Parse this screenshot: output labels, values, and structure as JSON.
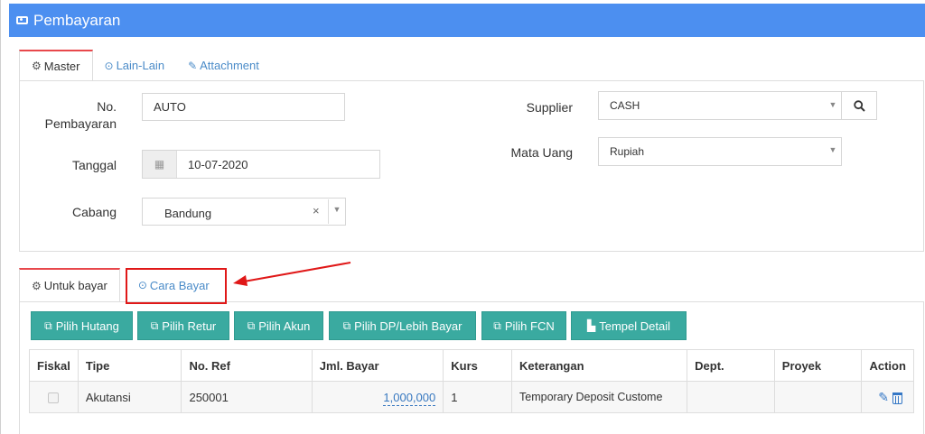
{
  "title": "Pembayaran",
  "top_tabs": [
    {
      "label": "Master",
      "icon": "cogs-icon",
      "active": true
    },
    {
      "label": "Lain-Lain",
      "icon": "check-circle-icon",
      "active": false
    },
    {
      "label": "Attachment",
      "icon": "paperclip-icon",
      "active": false
    }
  ],
  "form": {
    "no_pembayaran_label_1": "No.",
    "no_pembayaran_label_2": "Pembayaran",
    "no_pembayaran_value": "AUTO",
    "tanggal_label": "Tanggal",
    "tanggal_value": "10-07-2020",
    "cabang_label": "Cabang",
    "cabang_value": "Bandung",
    "cabang_clear": "×",
    "supplier_label": "Supplier",
    "supplier_value": "CASH",
    "mata_uang_label": "Mata Uang",
    "mata_uang_value": "Rupiah"
  },
  "bottom_tabs": [
    {
      "label": "Untuk bayar",
      "icon": "cogs-icon",
      "active": true
    },
    {
      "label": "Cara Bayar",
      "icon": "check-circle-icon",
      "active": false
    }
  ],
  "buttons": [
    {
      "label": "Pilih Hutang",
      "icon": "copy-icon"
    },
    {
      "label": "Pilih Retur",
      "icon": "copy-icon"
    },
    {
      "label": "Pilih Akun",
      "icon": "copy-icon"
    },
    {
      "label": "Pilih DP/Lebih Bayar",
      "icon": "copy-icon"
    },
    {
      "label": "Pilih FCN",
      "icon": "copy-icon"
    },
    {
      "label": "Tempel Detail",
      "icon": "paste-icon"
    }
  ],
  "table": {
    "columns": [
      "Fiskal",
      "Tipe",
      "No. Ref",
      "Jml. Bayar",
      "Kurs",
      "Keterangan",
      "Dept.",
      "Proyek",
      "Action"
    ],
    "rows": [
      {
        "fiskal": false,
        "tipe": "Akutansi",
        "no_ref": "250001",
        "jml_bayar": "1,000,000",
        "kurs": "1",
        "keterangan": "Temporary Deposit Custome",
        "dept": "",
        "proyek": ""
      }
    ]
  },
  "colors": {
    "header_bg": "#4c8ff0",
    "button_bg": "#3aaaa0",
    "active_tab_accent": "#e8484c",
    "link_blue": "#4a8bc8",
    "annotation_red": "#e01818"
  }
}
